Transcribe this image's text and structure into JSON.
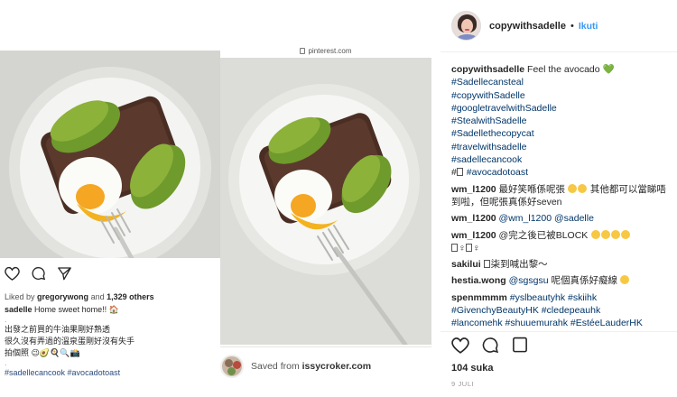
{
  "left_post": {
    "liked_by_prefix": "Liked by",
    "liked_by_user": "gregorywong",
    "liked_by_and": "and",
    "liked_by_count": "1,329 others",
    "caption_user": "sadelle",
    "caption_text": "Home sweet home!!",
    "caption_emoji": "🏠",
    "line1": "出發之前買的牛油果剛好熟透",
    "line2": "很久沒有弄過的溫泉蛋剛好沒有失手",
    "line3": "拍個照",
    "line3_emoji": "😉🥑🍳🔍📸",
    "hashtags": "#sadellecancook #avocadotoast",
    "dot": "."
  },
  "pin": {
    "source_url": "pinterest.com",
    "saved_from_label": "Saved from",
    "saved_from_site": "issycroker.com"
  },
  "sidebar": {
    "username": "copywithsadelle",
    "separator": "•",
    "follow_label": "Ikuti",
    "caption_user": "copywithsadelle",
    "caption_text": "Feel the avocado",
    "caption_emoji": "💚",
    "hashtags": [
      "#Sadellecansteal",
      "#copywithSadelle",
      "#googletravelwithSadelle",
      "#StealwithSadelle",
      "#Sadellethecopycat",
      "#travelwithsadelle",
      "#sadellecancook"
    ],
    "last_tag_box": "#",
    "last_tag": "#avocadotoast",
    "comments": [
      {
        "user": "wm_l1200",
        "text": "最好笑喺係呢張",
        "text2": "其他都可以當睇唔到啦，但呢張真係好seven"
      },
      {
        "user": "wm_l1200",
        "mention1": "@wm_l1200",
        "mention2": "@sadelle"
      },
      {
        "user": "wm_l1200",
        "text": "@完之後已被BLOCK",
        "text2": "♀"
      },
      {
        "user": "sakilui",
        "text": "柒到喊出黎～"
      },
      {
        "user": "hestia.wong",
        "mention": "@sgsgsu",
        "text": "呢個真係好癡線"
      },
      {
        "user": "spenmmmm",
        "text": "#yslbeautyhk #skiihk #GivenchyBeautyHK #cledepeauhk",
        "text_cut": "#lancomehk #shuuemurahk #EstéeLauderHK"
      }
    ],
    "likes": "104 suka",
    "date": "9 JULI"
  },
  "colors": {
    "link_blue": "#003569",
    "follow_blue": "#3897f0",
    "text": "#262626",
    "muted": "#999999"
  },
  "icons": [
    "heart-icon",
    "comment-icon",
    "share-icon",
    "bookmark-icon",
    "lock-icon"
  ]
}
